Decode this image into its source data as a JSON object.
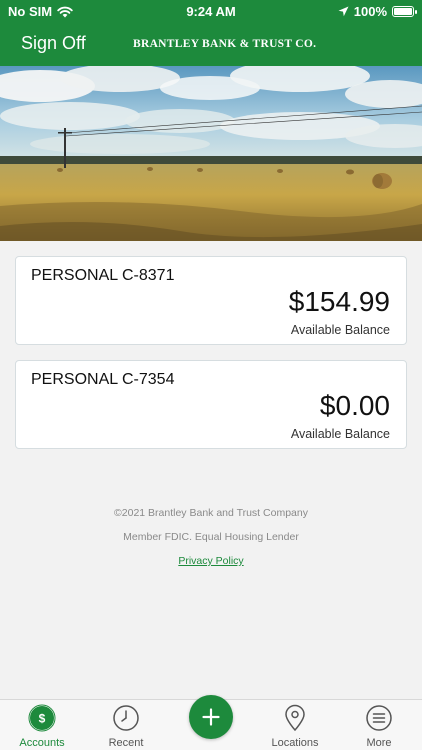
{
  "status_bar": {
    "carrier": "No SIM",
    "time": "9:24 AM",
    "battery": "100%"
  },
  "header": {
    "sign_off": "Sign Off",
    "brand": "BRANTLEY BANK & TRUST CO."
  },
  "accounts": [
    {
      "name": "PERSONAL C-8371",
      "balance": "$154.99",
      "caption": "Available Balance"
    },
    {
      "name": "PERSONAL C-7354",
      "balance": "$0.00",
      "caption": "Available Balance"
    }
  ],
  "footer": {
    "copyright": "©2021 Brantley Bank and Trust Company",
    "member": "Member FDIC. Equal Housing Lender",
    "privacy": "Privacy Policy"
  },
  "tabs": {
    "accounts": "Accounts",
    "recent": "Recent",
    "locations": "Locations",
    "more": "More"
  },
  "colors": {
    "brand_green": "#1d8a3c",
    "background": "#f2f2f2"
  }
}
